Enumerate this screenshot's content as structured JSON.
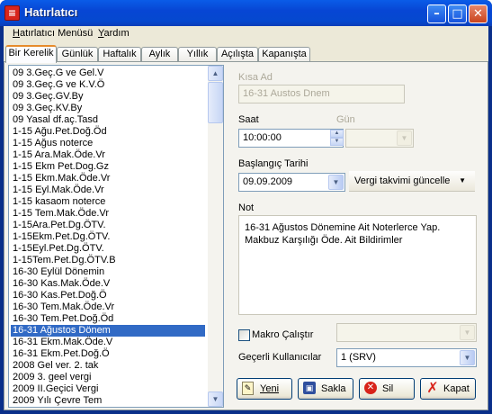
{
  "window": {
    "title": "Hatırlatıcı",
    "icon": "app-calendar-icon"
  },
  "menu": {
    "items": [
      {
        "label_u": "H",
        "label_rest": "atırlatıcı Menüsü"
      },
      {
        "label_u": "Y",
        "label_rest": "ardım"
      }
    ]
  },
  "tabs": [
    "Bir Kerelik",
    "Günlük",
    "Haftalık",
    "Aylık",
    "Yıllık",
    "Açılışta",
    "Kapanışta"
  ],
  "list": {
    "items": [
      "09 3.Geç.G ve Gel.V",
      "09 3.Geç.G ve K.V.Ö",
      "09 3.Geç.GV.By",
      "09 3.Geç.KV.By",
      "09 Yasal df.aç.Tasd",
      "1-15 Ağu.Pet.Doğ.Öd",
      "1-15 Ağus noterce",
      "1-15 Ara.Mak.Öde.Vr",
      "1-15 Ekm Pet.Dog.Gz",
      "1-15 Ekm.Mak.Öde.Vr",
      "1-15 Eyl.Mak.Öde.Vr",
      "1-15 kasaom noterce",
      "1-15 Tem.Mak.Öde.Vr",
      "1-15Ara.Pet.Dg.ÖTV.",
      "1-15Ekm.Pet.Dg.ÖTV.",
      "1-15Eyl.Pet.Dg.ÖTV.",
      "1-15Tem.Pet.Dg.ÖTV.B",
      "16-30 Eylül Dönemin",
      "16-30 Kas.Mak.Öde.V",
      "16-30 Kas.Pet.Doğ.Ö",
      "16-30 Tem.Mak.Öde.Vr",
      "16-30 Tem.Pet.Doğ.Öd",
      "16-31 Ağustos Dönem",
      "16-31 Ekm.Mak.Öde.V",
      "16-31 Ekm.Pet.Doğ.Ö",
      "2008 Gel ver. 2. tak",
      "2009 3. geel vergi",
      "2009 II.Geçici Vergi",
      "2009 Yılı Çevre Tem"
    ],
    "selected_index": 22
  },
  "form": {
    "kisa_ad_label": "Kısa Ad",
    "kisa_ad_value": "16-31 Austos Dnem",
    "saat_label": "Saat",
    "saat_value": "10:00:00",
    "gun_label": "Gün",
    "gun_value": "",
    "baslangic_label": "Başlangıç Tarihi",
    "baslangic_value": "09.09.2009",
    "update_button": "Vergi takvimi güncelle",
    "not_label": "Not",
    "not_value": "16-31 Ağustos Dönemine Ait Noterlerce Yap. Makbuz Karşılığı Öde. Ait Bildirimler",
    "makro_label": "Makro Çalıştır",
    "makro_value": "",
    "kullanicilar_label": "Geçerli Kullanıcılar",
    "kullanicilar_value": "1 (SRV)"
  },
  "buttons": {
    "yeni": "Yeni",
    "sakla": "Sakla",
    "sil": "Sil",
    "kapat": "Kapat"
  },
  "colors": {
    "selection": "#316ac5",
    "titlebar": "#0746d4",
    "tab_highlight": "#e68b2c"
  }
}
